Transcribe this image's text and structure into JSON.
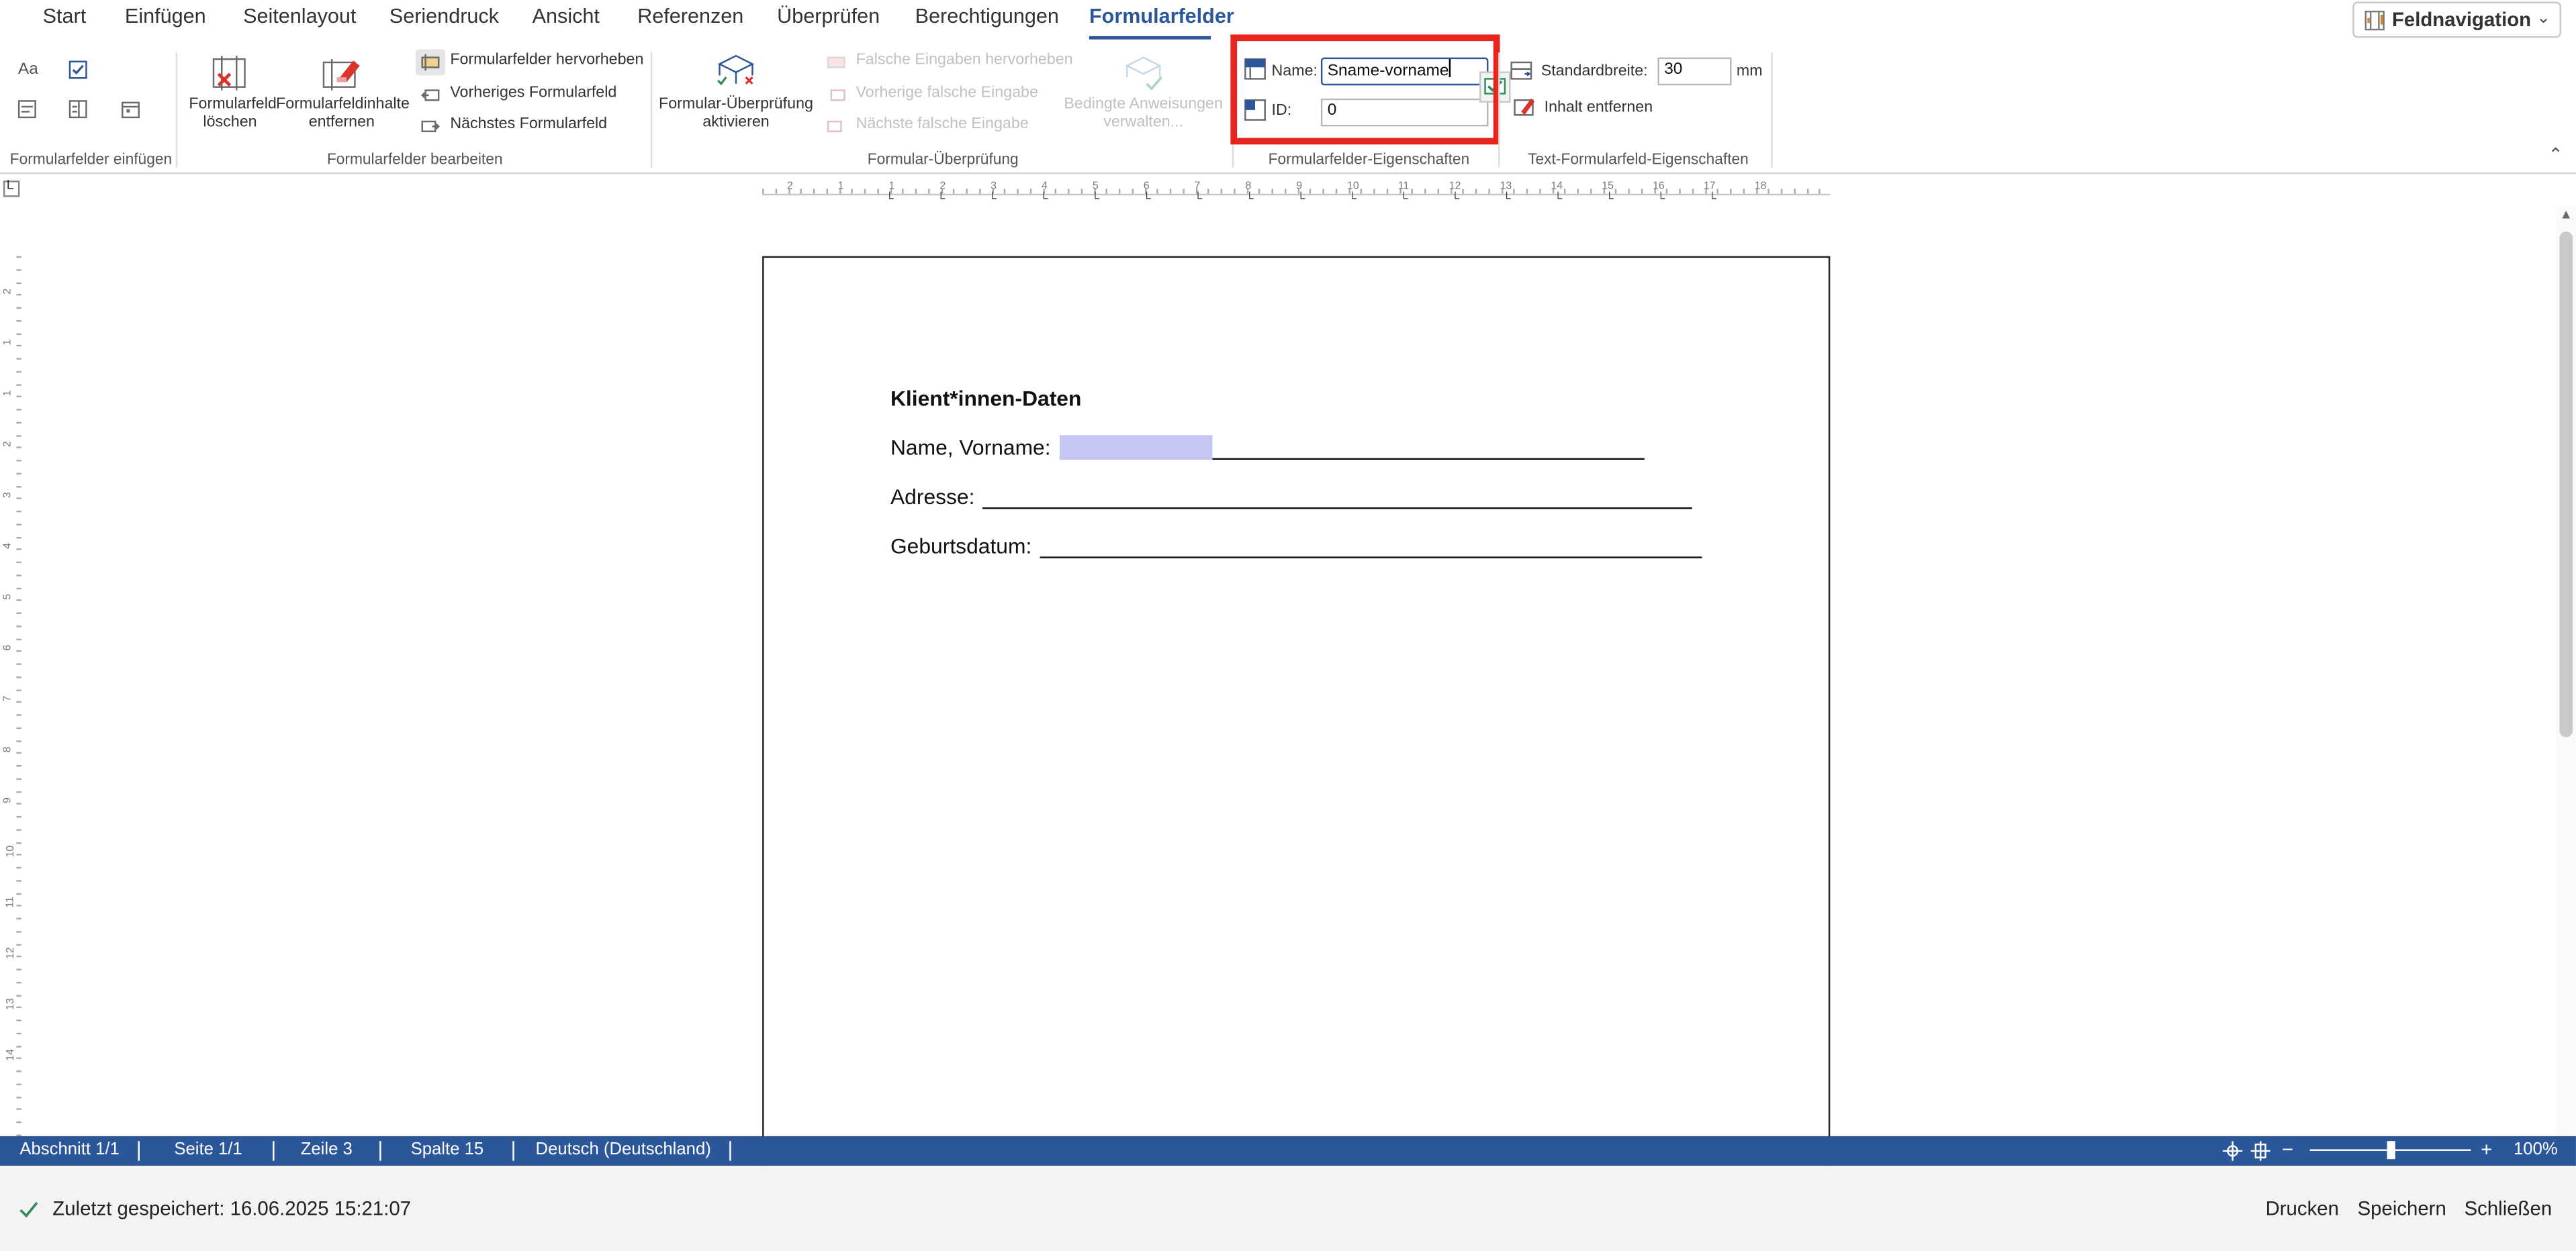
{
  "menu": {
    "tabs": [
      "Start",
      "Einfügen",
      "Seitenlayout",
      "Seriendruck",
      "Ansicht",
      "Referenzen",
      "Überprüfen",
      "Berechtigungen",
      "Formularfelder"
    ],
    "active_tab": "Formularfelder",
    "field_navigation": "Feldnavigation"
  },
  "ribbon": {
    "insert_group": {
      "text_icon_label": "Aa",
      "label": "Formularfelder einfügen"
    },
    "edit_group": {
      "delete_field": "Formularfeld löschen",
      "delete_field_l1": "Formularfeld",
      "delete_field_l2": "löschen",
      "remove_contents_l1": "Formularfeldinhalte",
      "remove_contents_l2": "entfernen",
      "highlight": "Formularfelder hervorheben",
      "previous": "Vorheriges Formularfeld",
      "next": "Nächstes Formularfeld",
      "label": "Formularfelder bearbeiten"
    },
    "validation_group": {
      "activate_l1": "Formular-Überprüfung",
      "activate_l2": "aktivieren",
      "highlight_wrong": "Falsche Eingaben hervorheben",
      "previous_wrong": "Vorherige falsche Eingabe",
      "next_wrong": "Nächste falsche Eingabe",
      "conditional_l1": "Bedingte Anweisungen",
      "conditional_l2": "verwalten...",
      "label": "Formular-Überprüfung"
    },
    "properties_group": {
      "name_label": "Name:",
      "name_value": "Sname-vorname",
      "id_label": "ID:",
      "id_value": "0",
      "label": "Formularfelder-Eigenschaften"
    },
    "text_properties_group": {
      "width_label": "Standardbreite:",
      "width_value": "30",
      "width_unit": "mm",
      "clear_content": "Inhalt entfernen",
      "label": "Text-Formularfeld-Eigenschaften"
    }
  },
  "ruler": {
    "top_numbers": [
      "2",
      "1",
      "1",
      "2",
      "3",
      "4",
      "5",
      "6",
      "7",
      "8",
      "9",
      "10",
      "11",
      "12",
      "13",
      "14",
      "15",
      "16",
      "17",
      "18"
    ],
    "left_numbers": [
      "2",
      "1",
      "1",
      "2",
      "3",
      "4",
      "5",
      "6",
      "7",
      "8",
      "9",
      "10",
      "11",
      "12",
      "13",
      "14"
    ]
  },
  "document": {
    "heading": "Klient*innen-Daten",
    "name_label": "Name, Vorname:",
    "address_label": "Adresse:",
    "birthdate_label": "Geburtsdatum:"
  },
  "status_bar": {
    "section": "Abschnitt 1/1",
    "page": "Seite 1/1",
    "line": "Zeile 3",
    "column": "Spalte 15",
    "language": "Deutsch (Deutschland)",
    "zoom": "100%",
    "zoom_level": 0.5
  },
  "footer": {
    "saved": "Zuletzt gespeichert: 16.06.2025 15:21:07",
    "print": "Drucken",
    "save": "Speichern",
    "close": "Schließen"
  },
  "colors": {
    "accent": "#2b579a",
    "highlight_frame": "#e8251c",
    "field_shading": "#c4c7f5",
    "check": "#2e8b57"
  }
}
